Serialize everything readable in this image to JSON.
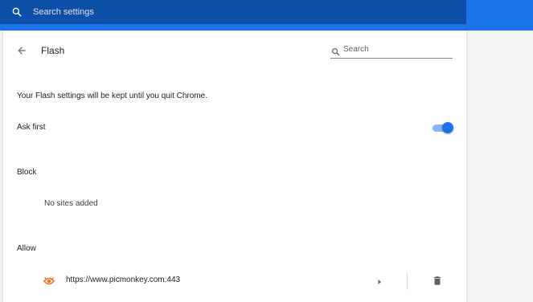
{
  "top_search": {
    "placeholder": "Search settings"
  },
  "header": {
    "title": "Flash",
    "search_placeholder": "Search"
  },
  "content": {
    "note": "Your Flash settings will be kept until you quit Chrome.",
    "ask_first": {
      "label": "Ask first",
      "enabled": true
    },
    "block": {
      "label": "Block",
      "empty_text": "No sites added"
    },
    "allow": {
      "label": "Allow",
      "sites": [
        {
          "url": "https://www.picmonkey.com:443",
          "icon": "picmonkey-site-icon"
        }
      ]
    }
  },
  "colors": {
    "accent": "#1a73e8",
    "accent_dark": "#0d4ea6",
    "toggle_track": "#8ab4f8",
    "site_icon": "#f2711c"
  },
  "icons": {
    "top_search": "search-icon",
    "back": "arrow-back-icon",
    "header_search": "search-icon",
    "expand": "play-arrow-icon",
    "delete": "trash-icon"
  }
}
